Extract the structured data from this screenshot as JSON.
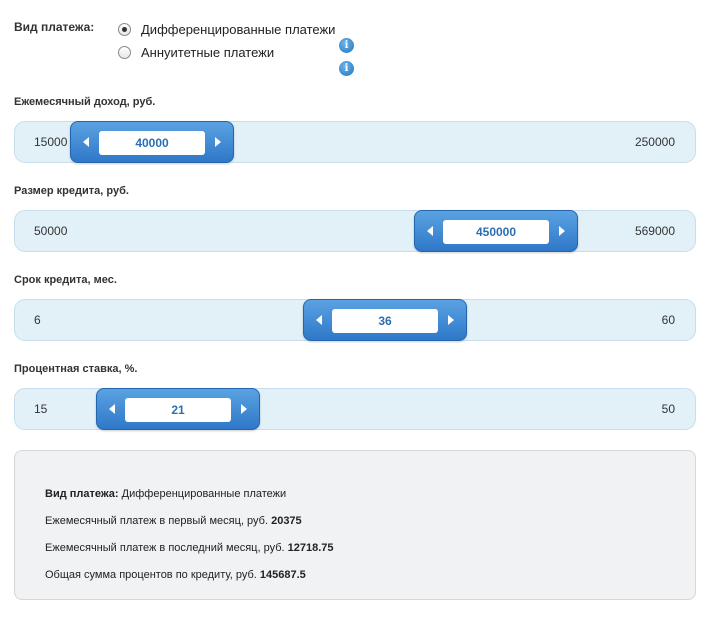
{
  "payment_type": {
    "label": "Вид платежа:",
    "options": [
      {
        "label": "Дифференцированные платежи",
        "checked": true
      },
      {
        "label": "Аннуитетные платежи",
        "checked": false
      }
    ],
    "info_glyph": "i"
  },
  "sliders": [
    {
      "label": "Ежемесячный доход, руб.",
      "min": "15000",
      "max": "250000",
      "value": "40000"
    },
    {
      "label": "Размер кредита, руб.",
      "min": "50000",
      "max": "569000",
      "value": "450000"
    },
    {
      "label": "Срок кредита, мес.",
      "min": "6",
      "max": "60",
      "value": "36"
    },
    {
      "label": "Процентная ставка, %.",
      "min": "15",
      "max": "50",
      "value": "21"
    }
  ],
  "result": {
    "type_label": "Вид платежа:",
    "type_value": "Дифференцированные платежи",
    "first_label": "Ежемесячный платеж в первый месяц, руб.",
    "first_value": "20375",
    "last_label": "Ежемесячный платеж в последний месяц, руб.",
    "last_value": "12718.75",
    "total_label": "Общая сумма процентов по кредиту, руб.",
    "total_value": "145687.5"
  },
  "colors": {
    "accent": "#2f78c8",
    "track": "#e2f0f8",
    "value_text": "#2a6fb4",
    "result_bg": "#f1f2f3"
  }
}
